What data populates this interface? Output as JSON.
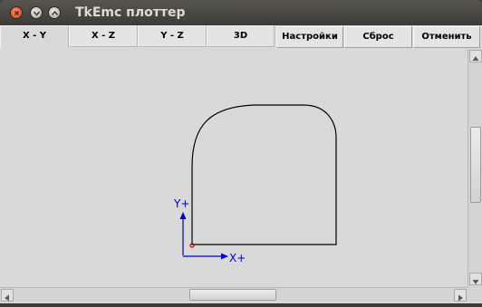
{
  "window": {
    "title": "TkEmc плоттер"
  },
  "tabs": [
    {
      "label": "X - Y",
      "active": true
    },
    {
      "label": "X - Z",
      "active": false
    },
    {
      "label": "Y - Z",
      "active": false
    },
    {
      "label": "3D",
      "active": false
    }
  ],
  "toolbar": {
    "settings_label": "Настройки",
    "reset_label": "Сброс",
    "cancel_label": "Отменить"
  },
  "plot": {
    "x_axis_label": "X+",
    "y_axis_label": "Y+",
    "axis_color": "#0000c8",
    "path_color": "#000000",
    "origin_color": "#c80000"
  },
  "icons": {
    "close": "close-icon",
    "minimize": "minimize-icon",
    "maximize": "maximize-icon"
  }
}
